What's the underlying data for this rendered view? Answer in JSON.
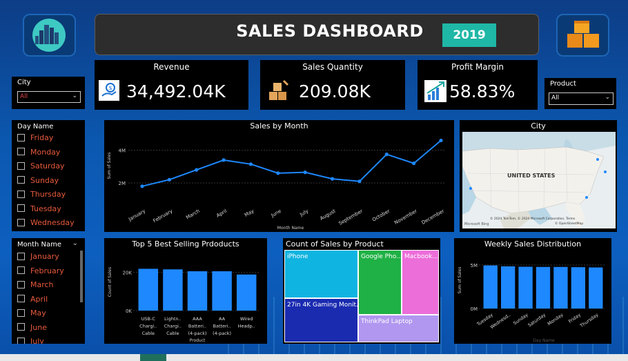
{
  "header": {
    "title": "SALES DASHBOARD",
    "year": "2019"
  },
  "kpis": {
    "revenue": {
      "label": "Revenue",
      "value": "34,492.04K"
    },
    "quantity": {
      "label": "Sales Quantity",
      "value": "209.08K"
    },
    "margin": {
      "label": "Profit Margin",
      "value": "58.83%"
    }
  },
  "filters": {
    "city": {
      "label": "City",
      "value": "All"
    },
    "product": {
      "label": "Product",
      "value": "All"
    }
  },
  "day_slicer": {
    "title": "Day Name",
    "items": [
      "Friday",
      "Monday",
      "Saturday",
      "Sunday",
      "Thursday",
      "Tuesday",
      "Wednesday"
    ]
  },
  "month_slicer": {
    "title": "Month Name",
    "items": [
      "January",
      "February",
      "March",
      "April",
      "May",
      "June",
      "July"
    ]
  },
  "map": {
    "title": "City",
    "country_label": "UNITED STATES",
    "attribution": "© 2024 TomTom, © 2024 Microsoft Corporation, Terms",
    "attribution2": "© OpenStreetMap",
    "brand": "Microsoft Bing"
  },
  "colors": {
    "accent": "#1e88ff",
    "title_bg": "#2d2d2d",
    "year_bg": "#1fb7a6",
    "slicer_text": "#e85a3c"
  },
  "chart_data": [
    {
      "type": "line",
      "title": "Sales by Month",
      "xlabel": "Month Name",
      "ylabel": "Sum of Sales",
      "categories": [
        "January",
        "February",
        "March",
        "April",
        "May",
        "June",
        "July",
        "August",
        "September",
        "October",
        "November",
        "December"
      ],
      "values": [
        1.8,
        2.2,
        2.8,
        3.4,
        3.15,
        2.6,
        2.65,
        2.25,
        2.1,
        3.75,
        3.2,
        4.6
      ],
      "yticks": [
        "2M",
        "4M"
      ],
      "ylim": [
        1.2,
        5.0
      ]
    },
    {
      "type": "bar",
      "title": "Top 5 Best Selling Prdoducts",
      "xlabel": "Product",
      "ylabel": "Count of Sales",
      "categories": [
        "USB-C Chargi.. Cable",
        "Lightn.. Chargi.. Cable",
        "AAA Batteri.. (4-pack)",
        "AA Batteri.. (4-pack)",
        "Wired Headp.."
      ],
      "values": [
        21.9,
        21.6,
        20.6,
        20.6,
        18.9
      ],
      "yticks": [
        "0K",
        "20K"
      ],
      "ylim": [
        0,
        30
      ]
    },
    {
      "type": "treemap",
      "title": "Count of Sales by Product",
      "categories": [
        "iPhone",
        "Google Pho...",
        "Macbook...",
        "27in 4K Gaming Monit...",
        "ThinkPad Laptop"
      ]
    },
    {
      "type": "bar",
      "title": "Weekly Sales Distribution",
      "xlabel": "Day Name",
      "ylabel": "Sum of Sales",
      "categories": [
        "Tuesday",
        "Wednesd..",
        "Sunday",
        "Saturday",
        "Monday",
        "Friday",
        "Thursday"
      ],
      "values": [
        4.95,
        4.85,
        4.8,
        4.78,
        4.78,
        4.75,
        4.72
      ],
      "yticks": [
        "0M",
        "5M"
      ],
      "ylim": [
        0,
        6.5
      ]
    }
  ]
}
